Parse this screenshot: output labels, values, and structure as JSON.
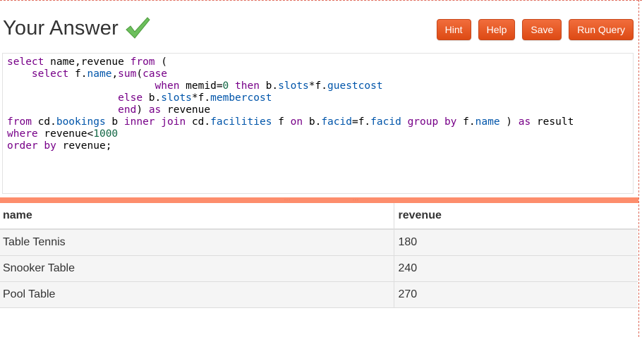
{
  "header": {
    "title": "Your Answer",
    "status_icon": "checkmark-icon",
    "check_color": "#5cb85c"
  },
  "toolbar": {
    "hint_label": "Hint",
    "help_label": "Help",
    "save_label": "Save",
    "run_label": "Run Query",
    "accent": "#e8562a"
  },
  "editor": {
    "lines": [
      "select name,revenue from (",
      "    select f.name,sum(case",
      "                        when memid=0 then b.slots*f.guestcost",
      "                  else b.slots*f.membercost",
      "                  end) as revenue",
      "from cd.bookings b inner join cd.facilities f on b.facid=f.facid group by f.name ) as result",
      "where revenue<1000",
      "order by revenue;"
    ]
  },
  "splitter": {
    "color": "#fd8d6c"
  },
  "results": {
    "columns": [
      "name",
      "revenue"
    ],
    "rows": [
      [
        "Table Tennis",
        "180"
      ],
      [
        "Snooker Table",
        "240"
      ],
      [
        "Pool Table",
        "270"
      ]
    ]
  }
}
